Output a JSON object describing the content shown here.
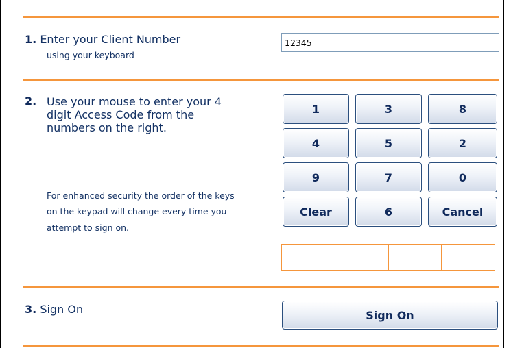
{
  "step1": {
    "number": "1.",
    "title": "Enter your Client Number",
    "subtitle": "using your keyboard",
    "client_number_value": "12345"
  },
  "step2": {
    "number": "2.",
    "description": "Use your mouse to enter your 4 digit Access Code from the numbers on the right.",
    "security_note": "For enhanced security the order of the keys on the keypad will change every time you attempt to sign on.",
    "keypad": {
      "row1": [
        "1",
        "3",
        "8"
      ],
      "row2": [
        "4",
        "5",
        "2"
      ],
      "row3": [
        "9",
        "7",
        "0"
      ],
      "row4": [
        "Clear",
        "6",
        "Cancel"
      ]
    },
    "code_digits_entered": [
      "",
      "",
      "",
      ""
    ]
  },
  "step3": {
    "number": "3.",
    "title": "Sign On",
    "button_label": "Sign On"
  },
  "colors": {
    "rule": "#f5963c",
    "text": "#143264",
    "button_border": "#2b4f7e"
  }
}
